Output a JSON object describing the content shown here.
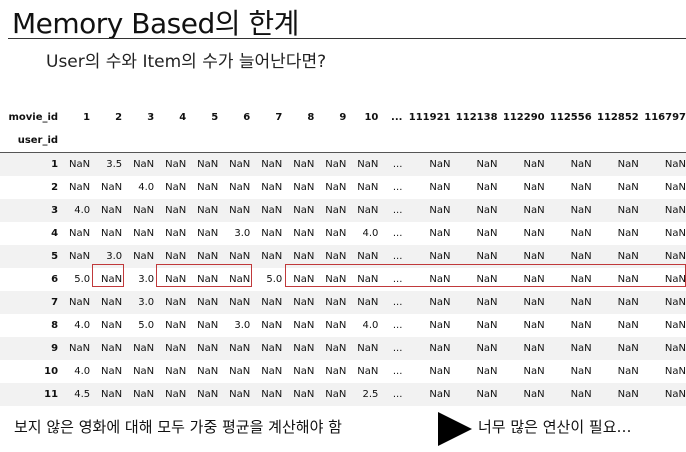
{
  "title": "Memory Based의 한계",
  "subtitle": "User의 수와 Item의 수가 늘어난다면?",
  "table": {
    "corner_header": "movie_id",
    "index_name": "user_id",
    "columns": [
      "1",
      "2",
      "3",
      "4",
      "5",
      "6",
      "7",
      "8",
      "9",
      "10",
      "...",
      "111921",
      "112138",
      "112290",
      "112556",
      "112852",
      "116797"
    ],
    "rows": [
      {
        "user": "1",
        "cells": [
          "NaN",
          "3.5",
          "NaN",
          "NaN",
          "NaN",
          "NaN",
          "NaN",
          "NaN",
          "NaN",
          "NaN",
          "...",
          "NaN",
          "NaN",
          "NaN",
          "NaN",
          "NaN",
          "NaN"
        ]
      },
      {
        "user": "2",
        "cells": [
          "NaN",
          "NaN",
          "4.0",
          "NaN",
          "NaN",
          "NaN",
          "NaN",
          "NaN",
          "NaN",
          "NaN",
          "...",
          "NaN",
          "NaN",
          "NaN",
          "NaN",
          "NaN",
          "NaN"
        ]
      },
      {
        "user": "3",
        "cells": [
          "4.0",
          "NaN",
          "NaN",
          "NaN",
          "NaN",
          "NaN",
          "NaN",
          "NaN",
          "NaN",
          "NaN",
          "...",
          "NaN",
          "NaN",
          "NaN",
          "NaN",
          "NaN",
          "NaN"
        ]
      },
      {
        "user": "4",
        "cells": [
          "NaN",
          "NaN",
          "NaN",
          "NaN",
          "NaN",
          "3.0",
          "NaN",
          "NaN",
          "NaN",
          "4.0",
          "...",
          "NaN",
          "NaN",
          "NaN",
          "NaN",
          "NaN",
          "NaN"
        ]
      },
      {
        "user": "5",
        "cells": [
          "NaN",
          "3.0",
          "NaN",
          "NaN",
          "NaN",
          "NaN",
          "NaN",
          "NaN",
          "NaN",
          "NaN",
          "...",
          "NaN",
          "NaN",
          "NaN",
          "NaN",
          "NaN",
          "NaN"
        ]
      },
      {
        "user": "6",
        "cells": [
          "5.0",
          "NaN",
          "3.0",
          "NaN",
          "NaN",
          "NaN",
          "5.0",
          "NaN",
          "NaN",
          "NaN",
          "...",
          "NaN",
          "NaN",
          "NaN",
          "NaN",
          "NaN",
          "NaN"
        ]
      },
      {
        "user": "7",
        "cells": [
          "NaN",
          "NaN",
          "3.0",
          "NaN",
          "NaN",
          "NaN",
          "NaN",
          "NaN",
          "NaN",
          "NaN",
          "...",
          "NaN",
          "NaN",
          "NaN",
          "NaN",
          "NaN",
          "NaN"
        ]
      },
      {
        "user": "8",
        "cells": [
          "4.0",
          "NaN",
          "5.0",
          "NaN",
          "NaN",
          "3.0",
          "NaN",
          "NaN",
          "NaN",
          "4.0",
          "...",
          "NaN",
          "NaN",
          "NaN",
          "NaN",
          "NaN",
          "NaN"
        ]
      },
      {
        "user": "9",
        "cells": [
          "NaN",
          "NaN",
          "NaN",
          "NaN",
          "NaN",
          "NaN",
          "NaN",
          "NaN",
          "NaN",
          "NaN",
          "...",
          "NaN",
          "NaN",
          "NaN",
          "NaN",
          "NaN",
          "NaN"
        ]
      },
      {
        "user": "10",
        "cells": [
          "4.0",
          "NaN",
          "NaN",
          "NaN",
          "NaN",
          "NaN",
          "NaN",
          "NaN",
          "NaN",
          "NaN",
          "...",
          "NaN",
          "NaN",
          "NaN",
          "NaN",
          "NaN",
          "NaN"
        ]
      },
      {
        "user": "11",
        "cells": [
          "4.5",
          "NaN",
          "NaN",
          "NaN",
          "NaN",
          "NaN",
          "NaN",
          "NaN",
          "NaN",
          "2.5",
          "...",
          "NaN",
          "NaN",
          "NaN",
          "NaN",
          "NaN",
          "NaN"
        ]
      }
    ]
  },
  "bottom_left_text": "보지 않은 영화에 대해 모두 가중 평균을 계산해야 함",
  "bottom_right_text": "너무 많은 연산이 필요…",
  "highlight_color": "#c0393b"
}
